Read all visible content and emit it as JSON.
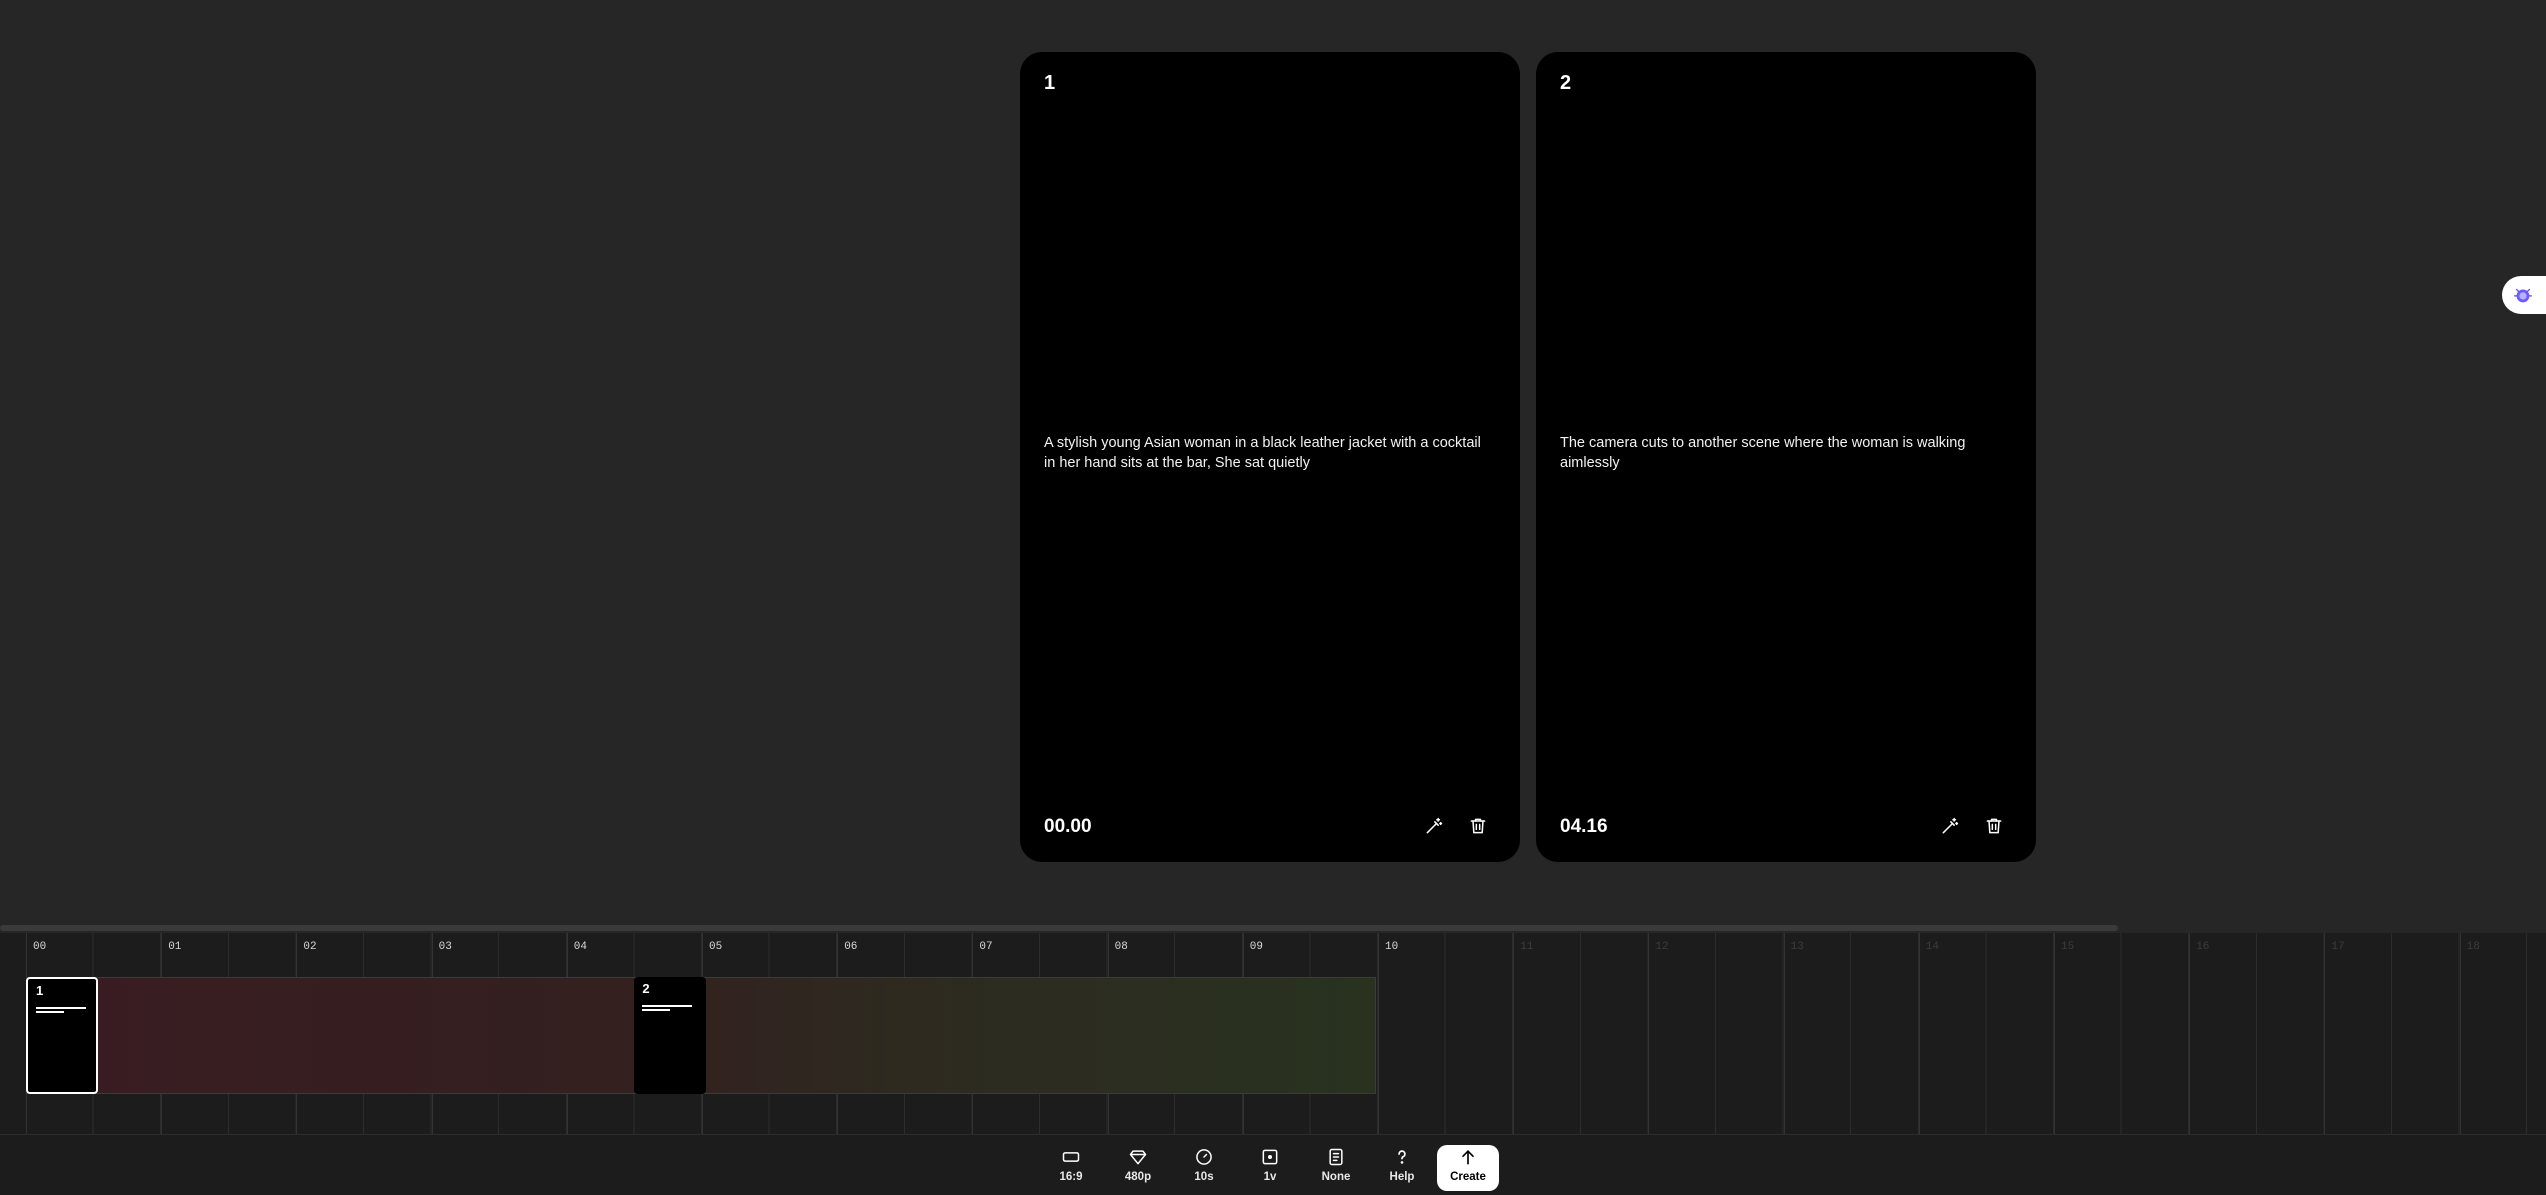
{
  "cards": [
    {
      "number": "1",
      "prompt": "A stylish young Asian woman in a black leather jacket with a cocktail in her hand sits at the bar, She sat quietly",
      "time": "00.00"
    },
    {
      "number": "2",
      "prompt": "The camera cuts to another scene where the woman is walking aimlessly",
      "time": "04.16"
    }
  ],
  "timeline": {
    "ticks": [
      "00",
      "01",
      "02",
      "03",
      "04",
      "05",
      "06",
      "07",
      "08",
      "09",
      "10",
      "11",
      "12",
      "13",
      "14",
      "15",
      "16",
      "17",
      "18"
    ],
    "active_until_seconds": 10,
    "clips": [
      {
        "number": "1",
        "start_seconds": 0.0,
        "selected": true
      },
      {
        "number": "2",
        "start_seconds": 4.5,
        "selected": false
      }
    ]
  },
  "toolbar": {
    "aspect_label": "16:9",
    "quality_label": "480p",
    "duration_label": "10s",
    "variations_label": "1v",
    "style_label": "None",
    "help_label": "Help",
    "create_label": "Create"
  },
  "icons": {
    "edit": "magic-wand-icon",
    "delete": "trash-icon",
    "extension": "extension-bug-icon"
  },
  "colors": {
    "background": "#262626",
    "card": "#000000",
    "timeline": "#1c1c1c",
    "accent_pill": "#6b5bff"
  }
}
